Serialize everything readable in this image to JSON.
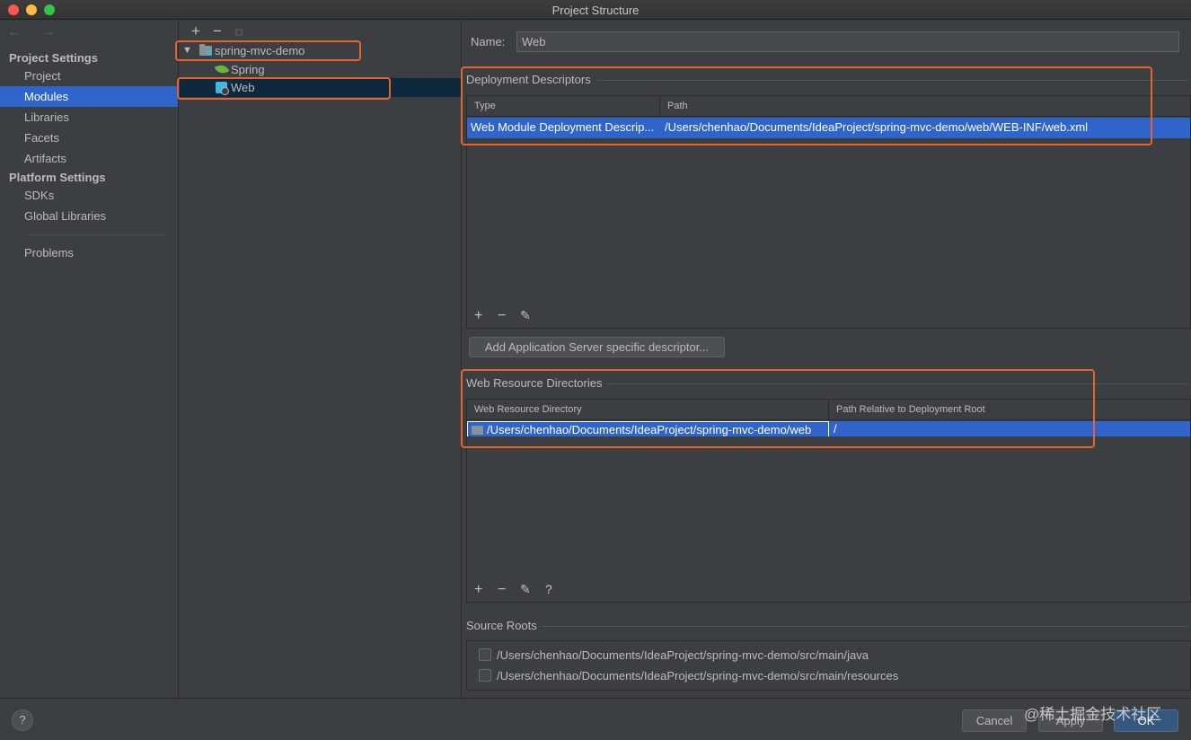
{
  "window": {
    "title": "Project Structure"
  },
  "colors": {
    "accent": "#2f65ca",
    "highlight": "#e8632b",
    "background": "#3c3f41"
  },
  "nav": {
    "arrows": "← →",
    "project_settings_header": "Project Settings",
    "project_items": [
      "Project",
      "Modules",
      "Libraries",
      "Facets",
      "Artifacts"
    ],
    "platform_settings_header": "Platform Settings",
    "platform_items": [
      "SDKs",
      "Global Libraries"
    ],
    "problems": "Problems",
    "selected": "Modules"
  },
  "tree": {
    "toolbar": {
      "add": "+",
      "remove": "−",
      "copy": "⧉"
    },
    "root": {
      "label": "spring-mvc-demo",
      "expanded": true,
      "icon": "module-folder-icon"
    },
    "children": [
      {
        "label": "Spring",
        "icon": "spring-leaf-icon"
      },
      {
        "label": "Web",
        "icon": "web-facet-icon",
        "selected": true
      }
    ]
  },
  "detail": {
    "name_label": "Name:",
    "name_value": "Web",
    "deployment": {
      "title": "Deployment Descriptors",
      "columns": [
        "Type",
        "Path"
      ],
      "rows": [
        {
          "type": "Web Module Deployment Descrip...",
          "path": "/Users/chenhao/Documents/IdeaProject/spring-mvc-demo/web/WEB-INF/web.xml"
        }
      ],
      "tools": {
        "add": "+",
        "remove": "−",
        "edit": "✎"
      },
      "add_server_button": "Add Application Server specific descriptor..."
    },
    "web_resources": {
      "title": "Web Resource Directories",
      "columns": [
        "Web Resource Directory",
        "Path Relative to Deployment Root"
      ],
      "rows": [
        {
          "directory": "/Users/chenhao/Documents/IdeaProject/spring-mvc-demo/web",
          "relative": "/"
        }
      ],
      "tools": {
        "add": "+",
        "remove": "−",
        "edit": "✎",
        "help": "?"
      }
    },
    "source_roots": {
      "title": "Source Roots",
      "items": [
        {
          "path": "/Users/chenhao/Documents/IdeaProject/spring-mvc-demo/src/main/java",
          "checked": false
        },
        {
          "path": "/Users/chenhao/Documents/IdeaProject/spring-mvc-demo/src/main/resources",
          "checked": false
        }
      ]
    }
  },
  "footer": {
    "help": "?",
    "cancel": "Cancel",
    "apply": "Apply",
    "ok": "OK",
    "watermark": "@稀土掘金技术社区"
  }
}
